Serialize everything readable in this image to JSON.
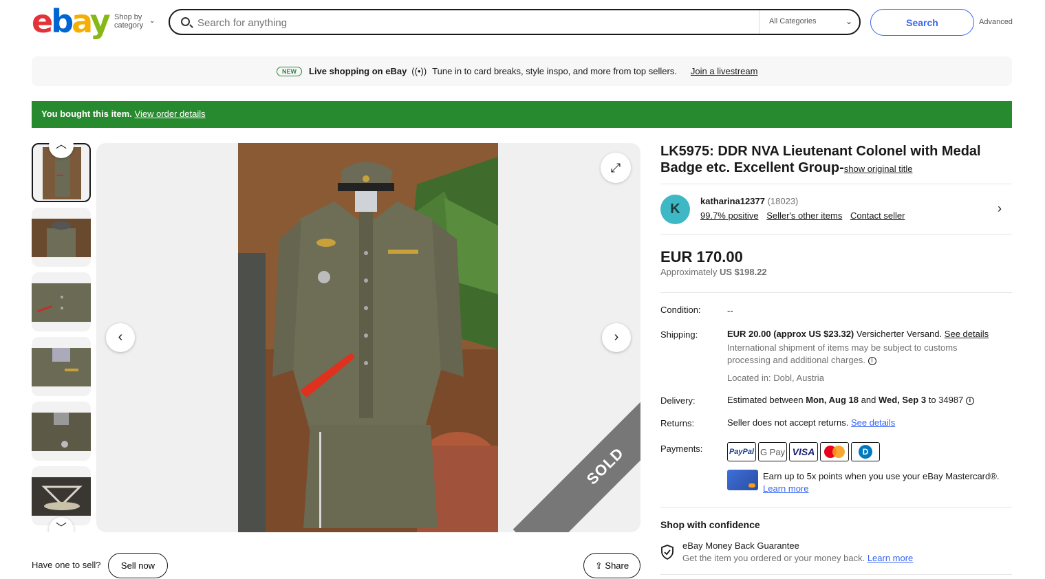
{
  "header": {
    "logo": [
      "e",
      "b",
      "a",
      "y"
    ],
    "shop_by": "Shop by",
    "category": "category",
    "search_placeholder": "Search for anything",
    "category_select": "All Categories",
    "search_button": "Search",
    "advanced": "Advanced"
  },
  "promo": {
    "badge": "NEW",
    "bold": "Live shopping on eBay",
    "text": "Tune in to card breaks, style inspo, and more from top sellers.",
    "link": "Join a livestream"
  },
  "bought_banner": {
    "text": "You bought this item.",
    "link": "View order details"
  },
  "gallery": {
    "sold_label": "SOLD",
    "have_one": "Have one to sell?",
    "sell_now": "Sell now",
    "share": "Share"
  },
  "item": {
    "title": "LK5975: DDR NVA Lieutenant Colonel with Medal Badge etc. Excellent Group-",
    "show_original": "show original title",
    "seller": {
      "initial": "K",
      "name": "katharina12377",
      "feedback_count": "(18023)",
      "positive": "99.7% positive",
      "other_items": "Seller's other items",
      "contact": "Contact seller"
    },
    "price": "EUR 170.00",
    "approx_label": "Approximately",
    "approx_value": "US $198.22",
    "condition": {
      "label": "Condition:",
      "value": "--"
    },
    "shipping": {
      "label": "Shipping:",
      "cost": "EUR 20.00 (approx US $23.32)",
      "method": "Versicherter Versand.",
      "see_details": "See details",
      "intl_note": "International shipment of items may be subject to customs processing and additional charges.",
      "location": "Located in: Dobl, Austria"
    },
    "delivery": {
      "label": "Delivery:",
      "pre": "Estimated between",
      "start": "Mon, Aug 18",
      "and": "and",
      "end": "Wed, Sep 3",
      "post": "to 34987"
    },
    "returns": {
      "label": "Returns:",
      "text": "Seller does not accept returns.",
      "link": "See details"
    },
    "payments": {
      "label": "Payments:",
      "paypal": "PayPal",
      "gpay": "G Pay",
      "visa": "VISA",
      "diners": "D",
      "card_promo": "Earn up to 5x points when you use your eBay Mastercard®.",
      "learn_more": "Learn more"
    },
    "confidence": {
      "title": "Shop with confidence",
      "mbg_title": "eBay Money Back Guarantee",
      "mbg_text": "Get the item you ordered or your money back.",
      "mbg_link": "Learn more"
    }
  },
  "colors": {
    "accent": "#3665f3",
    "success": "#278a2e",
    "sold_ribbon": "#777777"
  },
  "icons": [
    "search-icon",
    "chevron-down-icon",
    "live-stream-icon",
    "expand-icon",
    "chevron-left-icon",
    "chevron-right-icon",
    "chevron-up-icon",
    "share-icon",
    "info-icon",
    "shield-check-icon"
  ]
}
